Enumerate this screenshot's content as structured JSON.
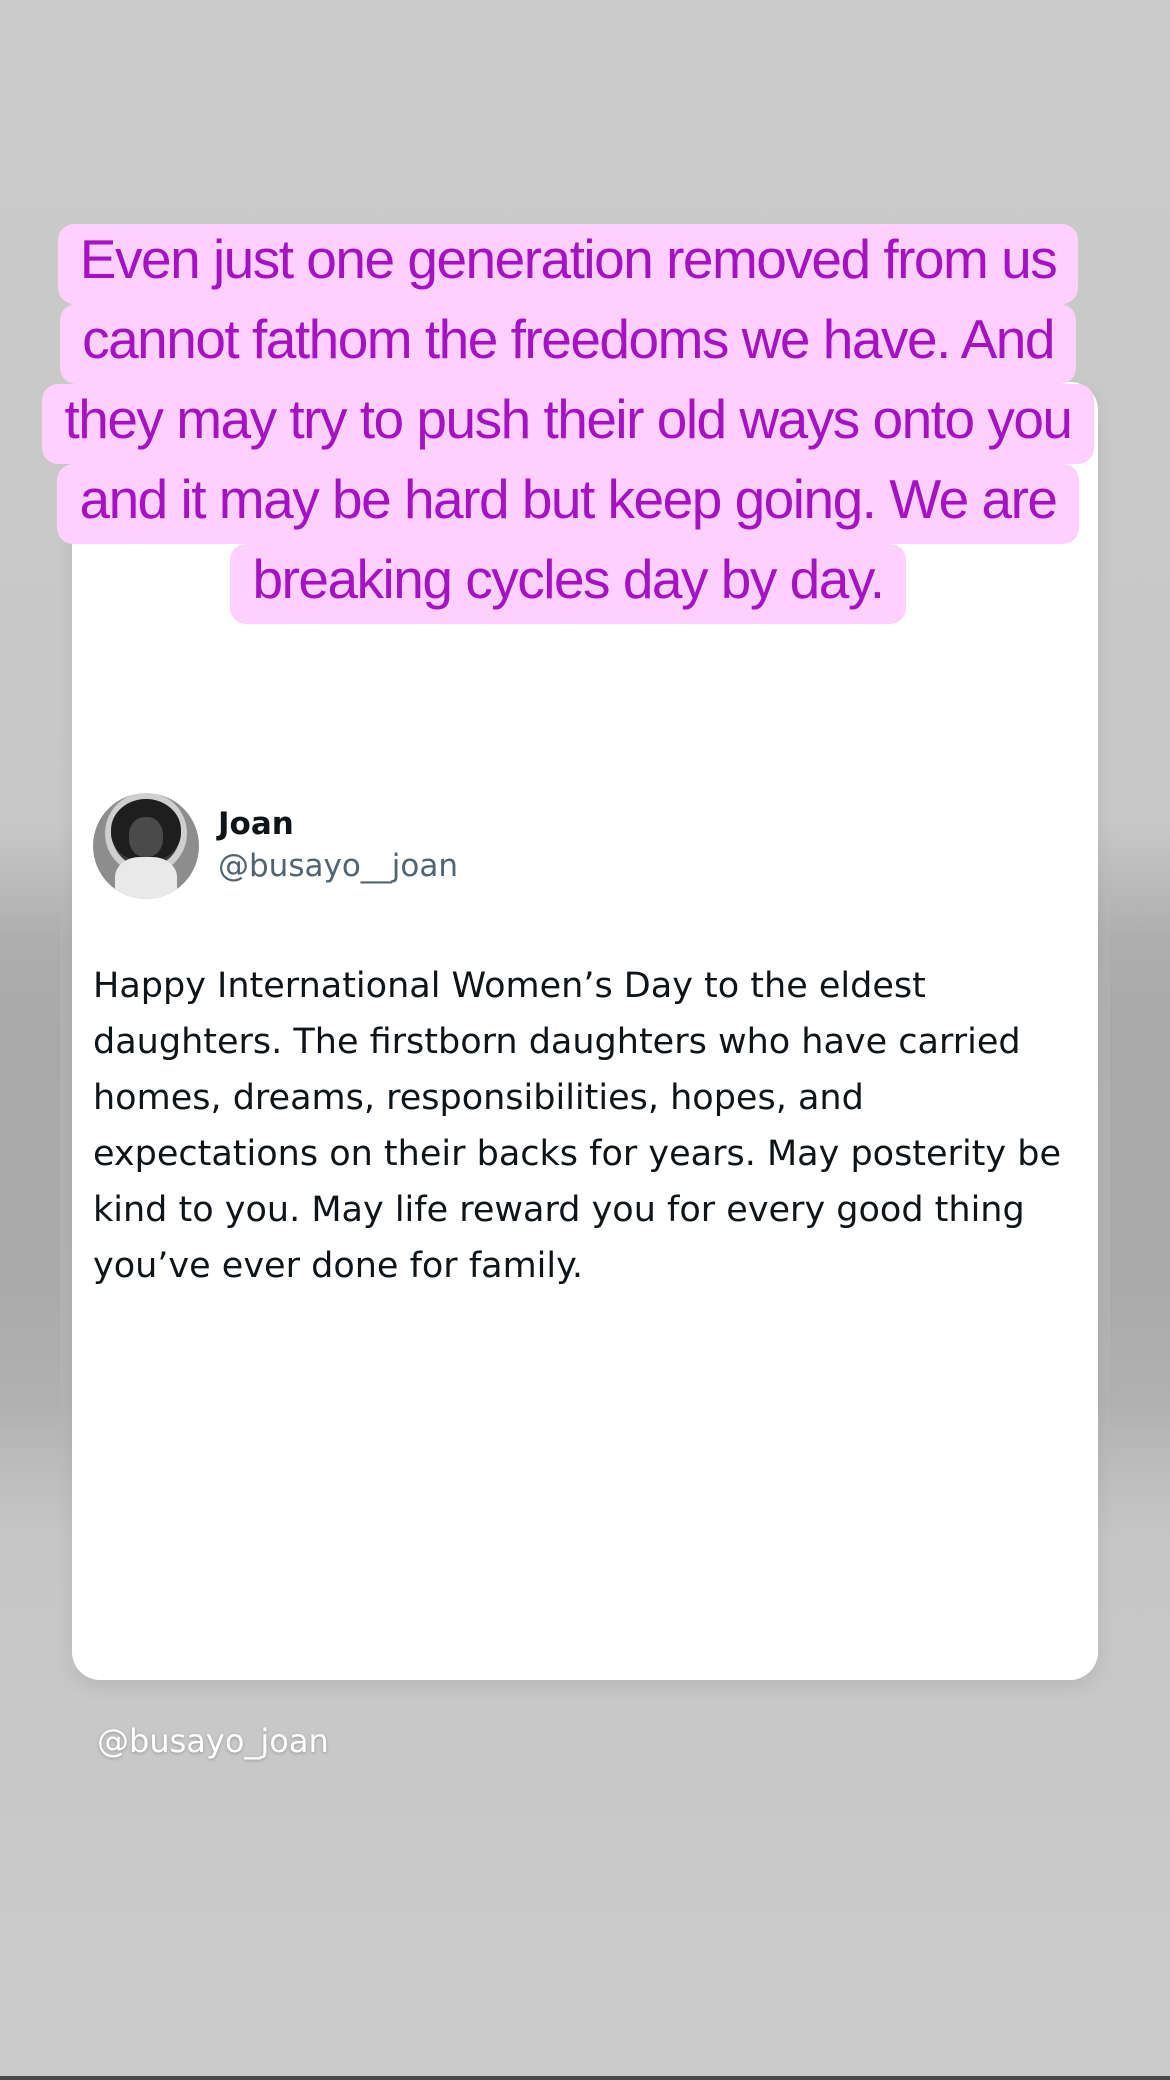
{
  "caption": {
    "text": "Even just one generation removed from us cannot fathom the freedoms we have. And they may try to push their old ways onto you and it may be hard but keep going. We are breaking cycles day by day.",
    "text_color": "#a412c3",
    "background_color": "#fdd0fd"
  },
  "tweet": {
    "display_name": "Joan",
    "handle": "@busayo__joan",
    "text": "Happy International Women’s Day to the eldest daughters. The firstborn daughters who have carried homes, dreams, responsibilities, hopes, and expectations on their backs for years. May posterity be kind to you. May life reward you for every good thing you’ve ever done for family."
  },
  "watermark": {
    "text": "@busayo_joan"
  }
}
